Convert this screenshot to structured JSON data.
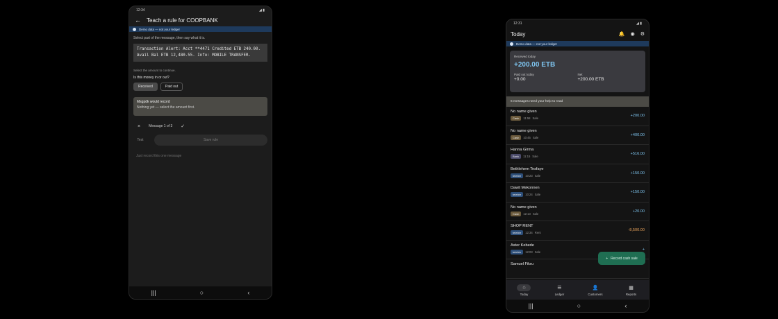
{
  "left_phone": {
    "status": {
      "time": "12:34",
      "right": "◢ ▮"
    },
    "appbar": {
      "title": "Teach a rule for COOPBANK"
    },
    "demo_banner": "Demo data — not your ledger",
    "instruction": "Select part of the message, then say what it is.",
    "sms": {
      "line1": "Transaction Alert: Acct **4471 Credited ETB 240.00.",
      "line2": "Avail Bal ETB 12,480.55. Info: MOBILE TRANSFER."
    },
    "select_amount_hint": "Select the amount to continue.",
    "direction_question": "Is this money in or out?",
    "chips": {
      "received": "Received",
      "paid_out": "Paid out"
    },
    "would_record": {
      "title": "Msgpdk would record",
      "subtitle": "Nothing yet — select the amount first."
    },
    "message_nav": {
      "label": "Message 1 of 3"
    },
    "test_label": "Test",
    "save_rule_label": "Save rule",
    "just_record_label": "Just record this one message"
  },
  "right_phone": {
    "status": {
      "time": "12:31",
      "right": "◢ ▮"
    },
    "appbar": {
      "title": "Today"
    },
    "demo_banner": "Demo data — not your ledger",
    "summary": {
      "received_label": "Received today",
      "received_value": "+200.00 ETB",
      "paid_label": "Paid out today",
      "paid_value": "+0.00",
      "net_label": "Net",
      "net_value": "+200.00 ETB"
    },
    "help_banner": "6 messages need your help to read",
    "rows": [
      {
        "name": "No name given",
        "tag": "Cash",
        "time": "11:58",
        "kind": "Sale",
        "amount": "+200.00"
      },
      {
        "name": "No name given",
        "tag": "Cash",
        "time": "10:45",
        "kind": "Sale",
        "amount": "+400.00"
      },
      {
        "name": "Hanna Girma",
        "tag": "Bank",
        "time": "11:15",
        "kind": "Sale",
        "amount": "+516.00"
      },
      {
        "name": "Bethlehem Tesfaye",
        "tag": "telebirr",
        "time": "10:23",
        "kind": "Sale",
        "amount": "+150.00"
      },
      {
        "name": "Dawit Mekonnen",
        "tag": "telebirr",
        "time": "10:24",
        "kind": "Sale",
        "amount": "+150.00"
      },
      {
        "name": "No name given",
        "tag": "Cash",
        "time": "12:13",
        "kind": "Sale",
        "amount": "+20.00"
      },
      {
        "name": "SHOP RENT",
        "tag": "telebirr",
        "time": "12:34",
        "kind": "Rent",
        "amount": "-8,500.00"
      },
      {
        "name": "Aster Kebede",
        "tag": "telebirr",
        "time": "12:03",
        "kind": "Sale",
        "amount": "+"
      },
      {
        "name": "Samuel Fikru",
        "tag": "",
        "time": "",
        "kind": "",
        "amount": ""
      }
    ],
    "fab_label": "Record cash sale",
    "bottom_nav": [
      {
        "label": "Today"
      },
      {
        "label": "Ledger"
      },
      {
        "label": "Customers"
      },
      {
        "label": "Reports"
      }
    ]
  }
}
